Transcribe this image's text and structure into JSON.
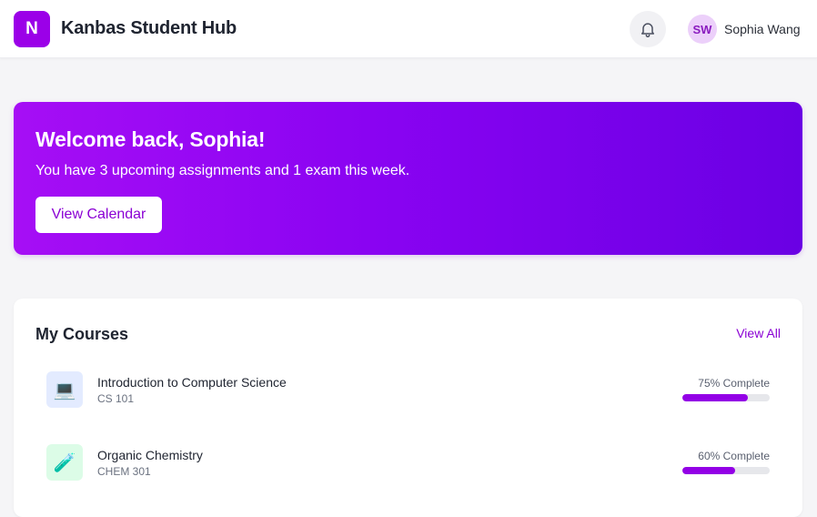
{
  "header": {
    "logo_letter": "N",
    "app_title": "Kanbas Student Hub",
    "notification_icon": "bell-icon",
    "user": {
      "initials": "SW",
      "name": "Sophia Wang"
    }
  },
  "hero": {
    "title": "Welcome back, Sophia!",
    "subtitle": "You have 3 upcoming assignments and 1 exam this week.",
    "button_label": "View Calendar"
  },
  "courses": {
    "title": "My Courses",
    "view_all_label": "View All",
    "items": [
      {
        "name": "Introduction to Computer Science",
        "code": "CS 101",
        "icon": "laptop-icon",
        "icon_glyph": "💻",
        "icon_bg": "#e3ebff",
        "progress_label": "75% Complete",
        "progress": 0.75
      },
      {
        "name": "Organic Chemistry",
        "code": "CHEM 301",
        "icon": "test-tube-icon",
        "icon_glyph": "🧪",
        "icon_bg": "#dcfce7",
        "progress_label": "60% Complete",
        "progress": 0.6
      }
    ]
  },
  "colors": {
    "brand": "#9b00e8",
    "accent_text": "#8a00d4",
    "progress_fill": "#9300e6",
    "progress_track": "#e6e7eb"
  }
}
